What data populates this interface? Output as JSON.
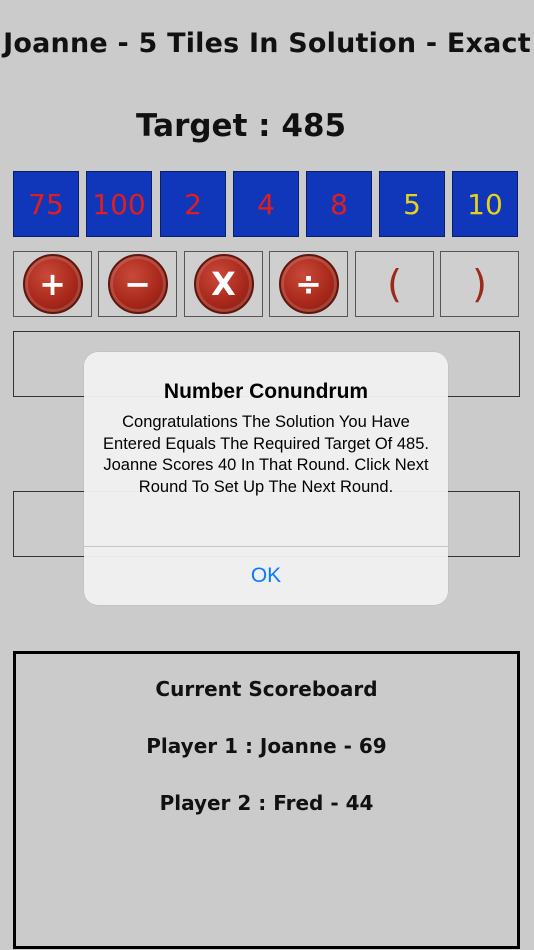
{
  "header": {
    "title": "Joanne - 5 Tiles In Solution - Exact"
  },
  "target": {
    "label": "Target : 485"
  },
  "tiles": [
    "75",
    "100",
    "2",
    "4",
    "8",
    "5",
    "10"
  ],
  "operators": {
    "plus": "+",
    "minus": "−",
    "multiply": "X",
    "divide": "÷",
    "open_paren": "(",
    "close_paren": ")"
  },
  "scoreboard": {
    "title": "Current Scoreboard",
    "player1": "Player 1 : Joanne - 69",
    "player2": "Player 2 : Fred - 44"
  },
  "alert": {
    "title": "Number Conundrum",
    "message": "Congratulations The Solution You Have Entered Equals The Required Target Of 485. Joanne Scores 40 In That Round. Click Next Round To Set Up The Next Round.",
    "ok_label": "OK"
  },
  "colors": {
    "tile_bg": "#1037b9",
    "tile_text_large": "#e21d1d",
    "tile_text_small": "#e6d21d",
    "operator_red": "#a8281b",
    "alert_button": "#0a7aff"
  }
}
